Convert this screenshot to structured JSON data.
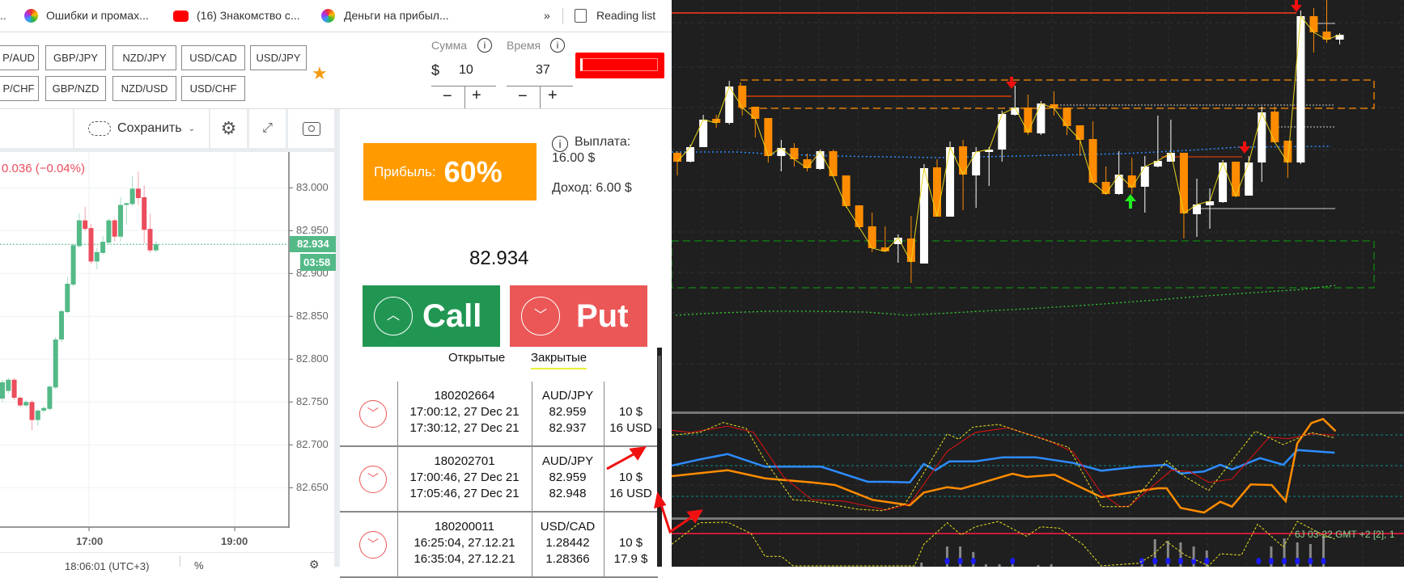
{
  "bookmarks": {
    "overflow_left": "..",
    "items": [
      {
        "label": "Ошибки и промах..."
      },
      {
        "label": "(16) Знакомство с..."
      },
      {
        "label": "Деньги на прибыл..."
      }
    ],
    "more": "»",
    "reading_list": "Reading list"
  },
  "pairs": {
    "row1": [
      "P/AUD",
      "GBP/JPY",
      "NZD/JPY",
      "USD/CAD",
      "USD/JPY"
    ],
    "row2": [
      "P/CHF",
      "GBP/NZD",
      "NZD/USD",
      "USD/CHF"
    ]
  },
  "amount": {
    "label": "Сумма",
    "currency": "$",
    "value": "10",
    "minus": "−",
    "plus": "+"
  },
  "time": {
    "label": "Время",
    "value": "37",
    "minus": "−",
    "plus": "+"
  },
  "info_glyph": "i",
  "toolbar": {
    "save_label": "Сохранить"
  },
  "chart": {
    "change": "0.036 (−0.04%)",
    "price_tag": "82.934",
    "countdown": "03:58",
    "y_ticks": [
      "83.000",
      "82.950",
      "82.900",
      "82.850",
      "82.800",
      "82.750",
      "82.700",
      "82.650"
    ],
    "x_ticks": [
      "17:00",
      "19:00"
    ],
    "footer_time": "18:06:01 (UTC+3)",
    "footer_pct": "%",
    "candles": [
      [
        82.754,
        82.776,
        82.75,
        82.773
      ],
      [
        82.763,
        82.778,
        82.76,
        82.776
      ],
      [
        82.776,
        82.778,
        82.752,
        82.755
      ],
      [
        82.755,
        82.757,
        82.744,
        82.746
      ],
      [
        82.746,
        82.752,
        82.744,
        82.75
      ],
      [
        82.75,
        82.752,
        82.717,
        82.729
      ],
      [
        82.729,
        82.742,
        82.722,
        82.74
      ],
      [
        82.74,
        82.745,
        82.737,
        82.743
      ],
      [
        82.742,
        82.77,
        82.74,
        82.768
      ],
      [
        82.767,
        82.826,
        82.765,
        82.823
      ],
      [
        82.823,
        82.858,
        82.82,
        82.856
      ],
      [
        82.855,
        82.896,
        82.853,
        82.888
      ],
      [
        82.887,
        82.935,
        82.885,
        82.933
      ],
      [
        82.932,
        82.97,
        82.93,
        82.962
      ],
      [
        82.962,
        82.978,
        82.95,
        82.952
      ],
      [
        82.953,
        82.958,
        82.911,
        82.914
      ],
      [
        82.914,
        82.93,
        82.905,
        82.925
      ],
      [
        82.924,
        82.944,
        82.922,
        82.937
      ],
      [
        82.936,
        82.964,
        82.934,
        82.962
      ],
      [
        82.962,
        82.964,
        82.937,
        82.943
      ],
      [
        82.943,
        82.989,
        82.937,
        82.98
      ],
      [
        82.98,
        82.983,
        82.957,
        82.982
      ],
      [
        82.981,
        83.014,
        82.979,
        82.999
      ],
      [
        82.999,
        83.019,
        82.98,
        82.988
      ],
      [
        82.989,
        83.003,
        82.935,
        82.951
      ],
      [
        82.952,
        82.97,
        82.924,
        82.927
      ],
      [
        82.927,
        82.938,
        82.925,
        82.934
      ]
    ]
  },
  "trade": {
    "profit_label": "Прибыль:",
    "profit_value": "60%",
    "payout_label": "Выплата:",
    "payout_value": "16.00 $",
    "income": "Доход: 6.00 $",
    "price": "82.934",
    "call": "Call",
    "put": "Put",
    "tabs": [
      "Открытые",
      "Закрытые"
    ]
  },
  "deals": [
    {
      "id": "180202664",
      "open": "17:00:12, 27 Dec 21",
      "close": "17:30:12, 27 Dec 21",
      "pair": "AUD/JPY",
      "open_price": "82.959",
      "close_price": "82.937",
      "stake": "10 $",
      "result": "16 USD"
    },
    {
      "id": "180202701",
      "open": "17:00:46, 27 Dec 21",
      "close": "17:05:46, 27 Dec 21",
      "pair": "AUD/JPY",
      "open_price": "82.959",
      "close_price": "82.948",
      "stake": "10 $",
      "result": "16 USD"
    },
    {
      "id": "180200011",
      "open": "16:25:04, 27.12.21",
      "close": "16:35:04, 27.12.21",
      "pair": "USD/CAD",
      "open_price": "1.28442",
      "close_price": "1.28366",
      "stake": "10 $",
      "result": "17.9 $"
    }
  ],
  "terminal": {
    "info": "6J 03-22 GMT +2 [2], 1"
  },
  "colors": {
    "orange": "#ff9900",
    "call": "#219653",
    "put": "#eb5757",
    "bull": "#53b987",
    "bear": "#eb4d5c",
    "dark_bg": "#1f1f1f"
  }
}
